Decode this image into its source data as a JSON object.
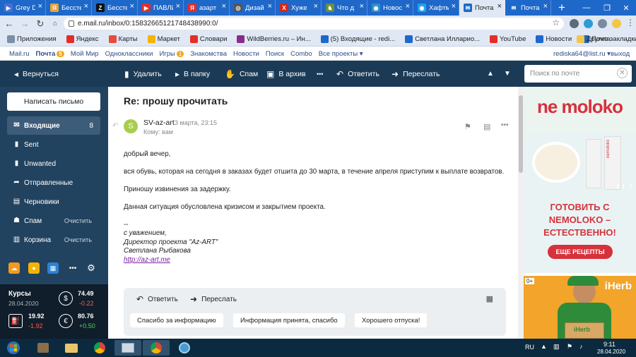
{
  "browser": {
    "tabs": [
      {
        "label": "Grey D",
        "fav_color": "#4a6fd4",
        "fav_char": "▶"
      },
      {
        "label": "Бессте",
        "fav_color": "#e8a33c",
        "fav_char": "Я"
      },
      {
        "label": "Бессте",
        "fav_color": "#111111",
        "fav_char": "Z"
      },
      {
        "label": "ПАВЛИ",
        "fav_color": "#e52d27",
        "fav_char": "▶"
      },
      {
        "label": "азарт",
        "fav_color": "#e52d27",
        "fav_char": "Я"
      },
      {
        "label": "Дизай",
        "fav_color": "#555555",
        "fav_char": "◎"
      },
      {
        "label": "Хуже",
        "fav_color": "#d8261c",
        "fav_char": "X"
      },
      {
        "label": "Что д",
        "fav_color": "#6d8f3a",
        "fav_char": "♞"
      },
      {
        "label": "Новос",
        "fav_color": "#2f8fcf",
        "fav_char": "◉"
      },
      {
        "label": "Хафтм",
        "fav_color": "#1ea1f2",
        "fav_char": "◉"
      },
      {
        "label": "Почта",
        "fav_color": "#1e68c9",
        "fav_char": "✉"
      },
      {
        "label": "Почта",
        "fav_color": "#1e68c9",
        "fav_char": "✉"
      }
    ],
    "active_tab": 10,
    "url": "e.mail.ru/inbox/0:15832665121748438990:0/",
    "bookmarks": [
      {
        "label": "Приложения",
        "color": "#7a8fa8"
      },
      {
        "label": "Яндекс",
        "color": "#e52d27"
      },
      {
        "label": "Карты",
        "color": "#e84a3c"
      },
      {
        "label": "Маркет",
        "color": "#f5b400"
      },
      {
        "label": "Словари",
        "color": "#e52d27"
      },
      {
        "label": "WildBerries.ru – Ин...",
        "color": "#8c2a8c"
      },
      {
        "label": "(5) Входящие - redi...",
        "color": "#1e68c9"
      },
      {
        "label": "Светлана Илларио...",
        "color": "#1e68c9"
      },
      {
        "label": "YouTube",
        "color": "#e52d27"
      },
      {
        "label": "Новости",
        "color": "#1e68c9"
      },
      {
        "label": "Почта",
        "color": "#1e68c9"
      }
    ],
    "other_bookmarks": "Другие закладки"
  },
  "portal": {
    "links": [
      "Mail.ru",
      "Почта",
      "Мой Мир",
      "Одноклассники",
      "Игры",
      "Знакомства",
      "Новости",
      "Поиск",
      "Combo",
      "Все проекты ▾"
    ],
    "mail_badge": "5",
    "games_badge": "1",
    "user": "rediska64@list.ru ▾",
    "logout": "выход"
  },
  "toolbar": {
    "back": "Вернуться",
    "delete": "Удалить",
    "to_folder": "В папку",
    "spam": "Спам",
    "archive": "В архив",
    "more": "•••",
    "reply": "Ответить",
    "forward": "Переслать",
    "search_placeholder": "Поиск по почте"
  },
  "sidebar": {
    "compose": "Написать письмо",
    "folders": [
      {
        "name": "Входящие",
        "count": "8",
        "action": "",
        "icon": "✉"
      },
      {
        "name": "Sent",
        "count": "",
        "action": "",
        "icon": "▮"
      },
      {
        "name": "Unwanted",
        "count": "",
        "action": "",
        "icon": "▮"
      },
      {
        "name": "Отправленные",
        "count": "",
        "action": "",
        "icon": "➦"
      },
      {
        "name": "Черновики",
        "count": "",
        "action": "",
        "icon": "▤"
      },
      {
        "name": "Спам",
        "count": "",
        "action": "Очистить",
        "icon": "☗"
      },
      {
        "name": "Корзина",
        "count": "",
        "action": "Очистить",
        "icon": "▥"
      }
    ],
    "rates": {
      "title": "Курсы",
      "date": "28.04.2020",
      "usd": "74.49",
      "usd_change": "-0.22",
      "oil": "19.92",
      "oil_change": "-1.92",
      "eur": "80.76",
      "eur_change": "+0.50"
    }
  },
  "message": {
    "subject": "Re: прошу прочитать",
    "avatar_letter": "S",
    "sender": "SV-az-art",
    "date": "3 марта, 23:15",
    "to": "Кому: вам",
    "body": [
      "добрый вечер,",
      "вся обувь, которая на сегодня в заказах будет отшита до 30 марта, в течение апреля приступим к выплате возвратов.",
      "Приношу извинения за задержку.",
      "Данная ситуация обусловлена кризисом и закрытием проекта."
    ],
    "signature": [
      "--",
      "с уважением,",
      "Директор проекта \"Az-ART\"",
      "Светлана Рыбакова"
    ],
    "link": "http://az-art.me",
    "reply_label": "Ответить",
    "forward_label": "Переслать",
    "quick_replies": [
      "Спасибо за информацию",
      "Информация принята, спасибо",
      "Хорошего отпуска!"
    ]
  },
  "ads": {
    "brand": "ne moloko",
    "slogan": "ГОТОВИТЬ С NEMOLOKO – ЕСТЕСТВЕННО!",
    "cta": "ЕЩЕ РЕЦЕПТЫ",
    "pack_label": "nemoloko",
    "age_rating": "0+",
    "brand2": "iHerb",
    "box_label": "iHerb"
  },
  "taskbar": {
    "lang": "RU",
    "time": "9:11",
    "date": "28.04.2020"
  }
}
